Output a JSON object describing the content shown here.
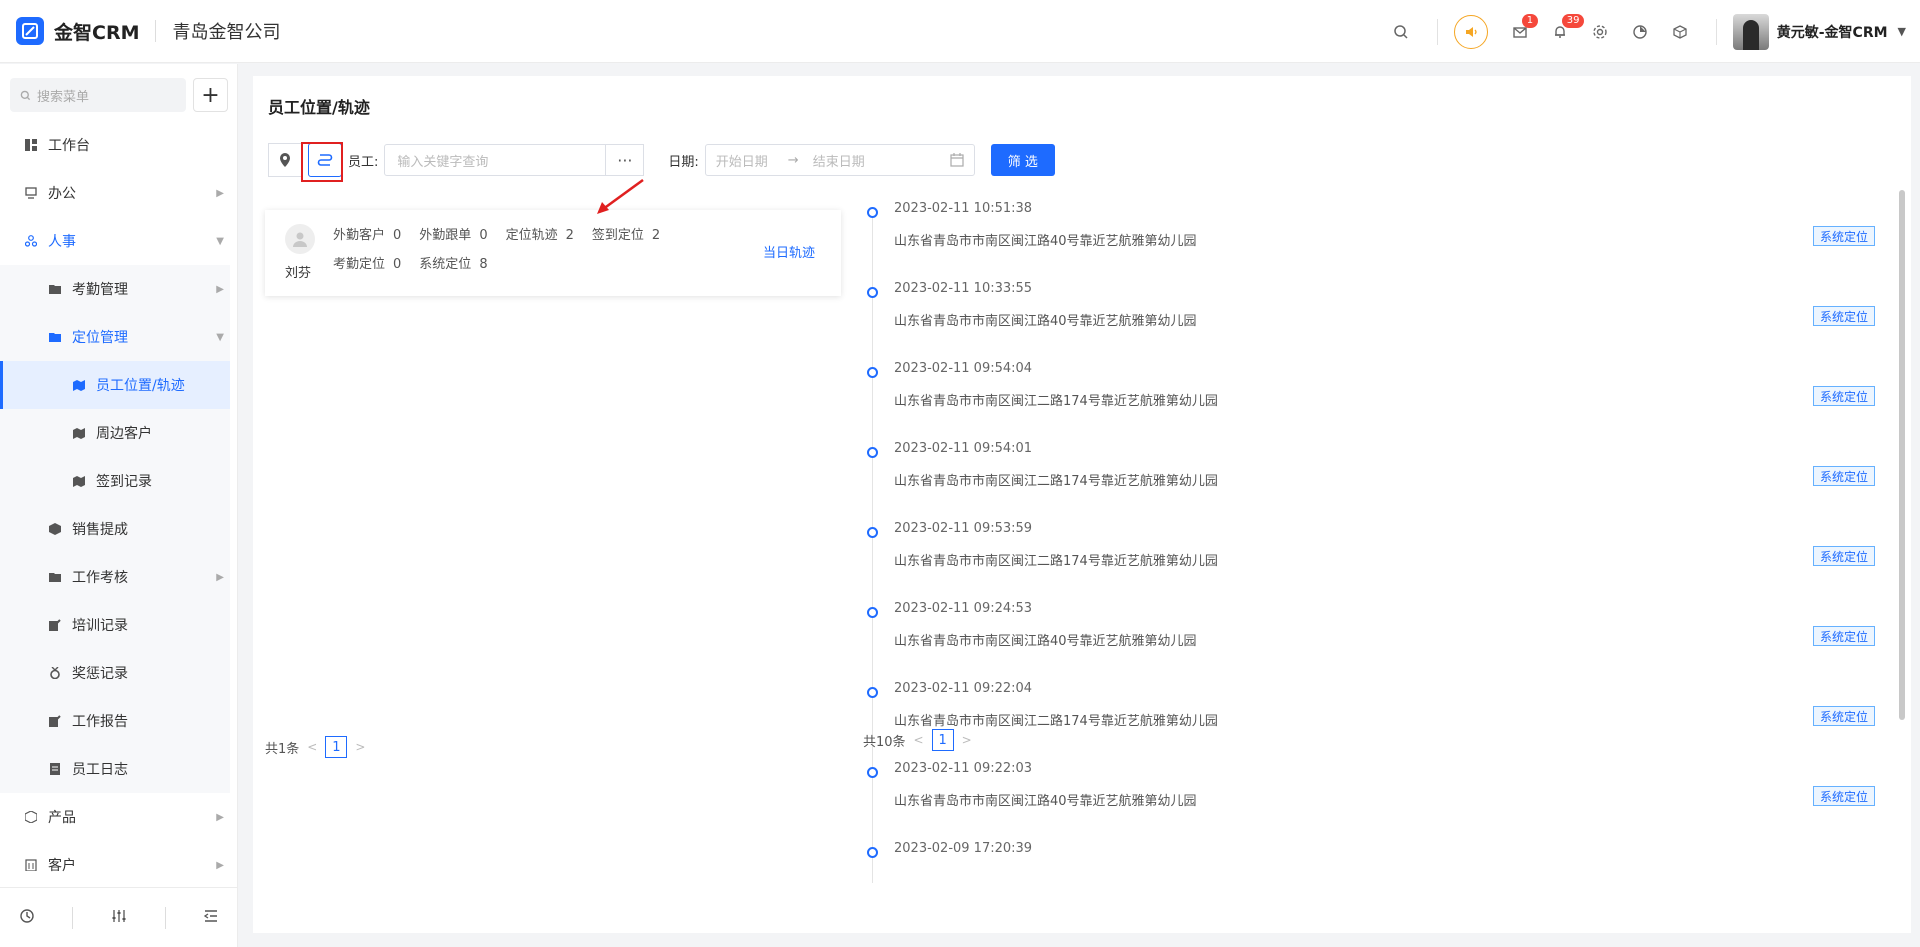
{
  "header": {
    "brand": "金智CRM",
    "company": "青岛金智公司",
    "mail_badge": "1",
    "bell_badge": "39",
    "username": "黄元敏-金智CRM"
  },
  "sidebar": {
    "search_placeholder": "搜索菜单",
    "items": [
      {
        "label": "工作台",
        "icon": "dashboard-icon"
      },
      {
        "label": "办公",
        "icon": "monitor-icon"
      },
      {
        "label": "人事",
        "icon": "people-icon"
      },
      {
        "label": "考勤管理",
        "icon": "folder-icon"
      },
      {
        "label": "定位管理",
        "icon": "folder-icon"
      },
      {
        "label": "员工位置/轨迹",
        "icon": "map-icon"
      },
      {
        "label": "周边客户",
        "icon": "map-icon"
      },
      {
        "label": "签到记录",
        "icon": "map-icon"
      },
      {
        "label": "销售提成",
        "icon": "cube-icon"
      },
      {
        "label": "工作考核",
        "icon": "folder-icon"
      },
      {
        "label": "培训记录",
        "icon": "edit-icon"
      },
      {
        "label": "奖惩记录",
        "icon": "medal-icon"
      },
      {
        "label": "工作报告",
        "icon": "edit-icon"
      },
      {
        "label": "员工日志",
        "icon": "doc-icon"
      },
      {
        "label": "产品",
        "icon": "box-icon"
      },
      {
        "label": "客户",
        "icon": "building-icon"
      }
    ]
  },
  "main": {
    "title": "员工位置/轨迹",
    "filter": {
      "employee_label": "员工:",
      "keyword_placeholder": "输入关键字查询",
      "more": "···",
      "date_label": "日期:",
      "start_placeholder": "开始日期",
      "end_placeholder": "结束日期",
      "date_arrow": "→",
      "submit": "筛 选"
    },
    "employee": {
      "name": "刘芬",
      "stats": [
        {
          "label": "外勤客户",
          "value": "0"
        },
        {
          "label": "外勤跟单",
          "value": "0"
        },
        {
          "label": "定位轨迹",
          "value": "2"
        },
        {
          "label": "签到定位",
          "value": "2"
        },
        {
          "label": "考勤定位",
          "value": "0"
        },
        {
          "label": "系统定位",
          "value": "8"
        }
      ],
      "link": "当日轨迹"
    },
    "left_pager": {
      "total": "共1条",
      "page": "1"
    },
    "right_pager": {
      "total": "共10条",
      "page": "1"
    },
    "timeline": [
      {
        "time": "2023-02-11 10:51:38",
        "addr": "山东省青岛市市南区闽江路40号靠近艺航雅第幼儿园",
        "tag": "系统定位"
      },
      {
        "time": "2023-02-11 10:33:55",
        "addr": "山东省青岛市市南区闽江路40号靠近艺航雅第幼儿园",
        "tag": "系统定位"
      },
      {
        "time": "2023-02-11 09:54:04",
        "addr": "山东省青岛市市南区闽江二路174号靠近艺航雅第幼儿园",
        "tag": "系统定位"
      },
      {
        "time": "2023-02-11 09:54:01",
        "addr": "山东省青岛市市南区闽江二路174号靠近艺航雅第幼儿园",
        "tag": "系统定位"
      },
      {
        "time": "2023-02-11 09:53:59",
        "addr": "山东省青岛市市南区闽江二路174号靠近艺航雅第幼儿园",
        "tag": "系统定位"
      },
      {
        "time": "2023-02-11 09:24:53",
        "addr": "山东省青岛市市南区闽江路40号靠近艺航雅第幼儿园",
        "tag": "系统定位"
      },
      {
        "time": "2023-02-11 09:22:04",
        "addr": "山东省青岛市市南区闽江二路174号靠近艺航雅第幼儿园",
        "tag": "系统定位"
      },
      {
        "time": "2023-02-11 09:22:03",
        "addr": "山东省青岛市市南区闽江路40号靠近艺航雅第幼儿园",
        "tag": "系统定位"
      },
      {
        "time": "2023-02-09 17:20:39",
        "addr": "",
        "tag": ""
      }
    ]
  }
}
